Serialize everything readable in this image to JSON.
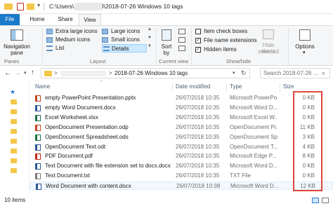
{
  "titlebar": {
    "path": "C:\\Users\\          \\2del\\2018-07-26 Windows 10 tags"
  },
  "tabs": [
    {
      "label": "File"
    },
    {
      "label": "Home"
    },
    {
      "label": "Share"
    },
    {
      "label": "View"
    }
  ],
  "ribbon": {
    "panes": {
      "navigation_pane": "Navigation",
      "navigation_pane_2": "pane",
      "group": "Panes"
    },
    "layout": {
      "extra_large": "Extra large icons",
      "large": "Large icons",
      "medium": "Medium icons",
      "small": "Small icons",
      "list": "List",
      "details": "Details",
      "group": "Layout"
    },
    "current_view": {
      "sort_by": "Sort",
      "sort_by_2": "by",
      "group": "Current view"
    },
    "show_hide": {
      "item_check_boxes": "Item check boxes",
      "file_name_extensions": "File name extensions",
      "hidden_items": "Hidden items",
      "hide_selected": "Hide selected",
      "hide_selected_2": "items",
      "group": "Show/hide"
    },
    "options": "Options",
    "checkbox_states": {
      "item_check_boxes": false,
      "file_name_extensions": true,
      "hidden_items": true
    }
  },
  "address": {
    "breadcrumb_arrow": ">",
    "current_folder": "2018-07-26 Windows 10 tags",
    "search_placeholder": "Search 2018-07-26 ..."
  },
  "columns": {
    "name": "Name",
    "date": "Date modified",
    "type": "Type",
    "size": "Size"
  },
  "files": [
    {
      "name": "empty PowerPoint Presentation.pptx",
      "date": "26/07/2018 10:35",
      "type": "Microsoft PowerPo...",
      "size": "0 KB",
      "icon": "powerpoint-icon",
      "color": "#c4411f"
    },
    {
      "name": "empty Word Document.docx",
      "date": "26/07/2018 10:35",
      "type": "Microsoft Word D...",
      "size": "0 KB",
      "icon": "word-icon",
      "color": "#2b5797"
    },
    {
      "name": "Excel Worksheet.xlsx",
      "date": "26/07/2018 10:35",
      "type": "Microsoft Excel W...",
      "size": "0 KB",
      "icon": "excel-icon",
      "color": "#1f7244"
    },
    {
      "name": "OpenDocument Presentation.odp",
      "date": "26/07/2018 10:35",
      "type": "OpenDocument Pr...",
      "size": "11 KB",
      "icon": "odp-icon",
      "color": "#c4411f"
    },
    {
      "name": "OpenDocument Spreadsheet.ods",
      "date": "26/07/2018 10:35",
      "type": "OpenDocument Sp...",
      "size": "3 KB",
      "icon": "ods-icon",
      "color": "#1f7244"
    },
    {
      "name": "OpenDocument Text.odt",
      "date": "26/07/2018 10:35",
      "type": "OpenDocument T...",
      "size": "4 KB",
      "icon": "odt-icon",
      "color": "#2b5797"
    },
    {
      "name": "PDF Document.pdf",
      "date": "26/07/2018 10:35",
      "type": "Microsoft Edge P...",
      "size": "8 KB",
      "icon": "pdf-icon",
      "color": "#c42b1c"
    },
    {
      "name": "Text Document with file extension set to docx.docx",
      "date": "26/07/2018 10:35",
      "type": "Microsoft Word D...",
      "size": "0 KB",
      "icon": "word-icon",
      "color": "#2b5797"
    },
    {
      "name": "Text Document.txt",
      "date": "26/07/2018 10:35",
      "type": "TXT File",
      "size": "0 KB",
      "icon": "text-icon",
      "color": "#7a7a7a"
    },
    {
      "name": "Word Document with content.docx",
      "date": "26/07/2018 10:38",
      "type": "Microsoft Word D...",
      "size": "12 KB",
      "icon": "word-icon",
      "color": "#2b5797"
    }
  ],
  "status": {
    "count": "10 items"
  },
  "colors": {
    "file_tab": "#1979ca",
    "accent": "#cce8ff",
    "highlight_box": "#e0463a",
    "selection": "#cce8ff"
  }
}
